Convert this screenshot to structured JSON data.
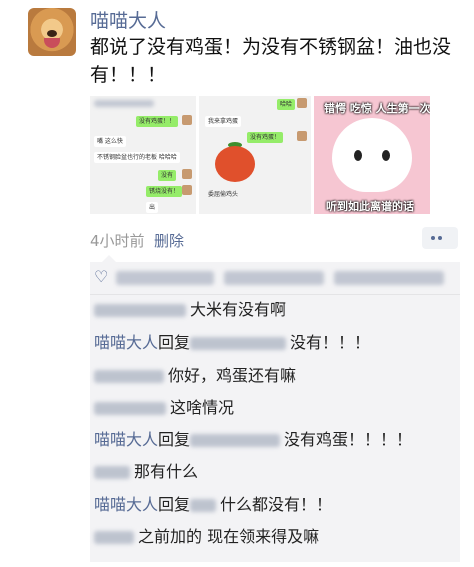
{
  "post": {
    "username": "喵喵大人",
    "text": "都说了没有鸡蛋！为没有不锈钢盆！油也没有！！！",
    "time": "4小时前",
    "delete_label": "删除"
  },
  "gallery": {
    "img1": {
      "bubbles": [
        "没有鸡蛋！！",
        "嘴 这么快",
        "不锈钢脸盆也行的老板 哈哈哈",
        "没有",
        "锈烧没有！",
        "出"
      ]
    },
    "img2": {
      "bubbles": [
        "哈哈",
        "我来拿鸡蛋",
        "没有鸡蛋！",
        "委屈偷鸡头"
      ]
    },
    "img3": {
      "top_caption": "错愕 吃惊 人生第一次",
      "bottom_caption": "听到如此离谱的话"
    }
  },
  "comments": [
    {
      "author": "",
      "reply_to": "",
      "text": "大米有没有啊"
    },
    {
      "author": "喵喵大人",
      "reply_to": "回复",
      "text": "没有！！！"
    },
    {
      "author": "",
      "reply_to": "",
      "text": "你好，鸡蛋还有嘛"
    },
    {
      "author": "",
      "reply_to": "",
      "text": "这啥情况"
    },
    {
      "author": "喵喵大人",
      "reply_to": "回复",
      "text": "没有鸡蛋！！！！"
    },
    {
      "author": "",
      "reply_to": "",
      "text": "那有什么"
    },
    {
      "author": "喵喵大人",
      "reply_to": "回复",
      "text": "什么都没有！！"
    },
    {
      "author": "",
      "reply_to": "",
      "text": "之前加的 现在领来得及嘛"
    }
  ],
  "icons": {
    "like": "heart-icon",
    "more": "more-dots-icon"
  },
  "colors": {
    "link": "#576b95",
    "comment_bg": "#f3f3f5",
    "muted": "#999999"
  }
}
